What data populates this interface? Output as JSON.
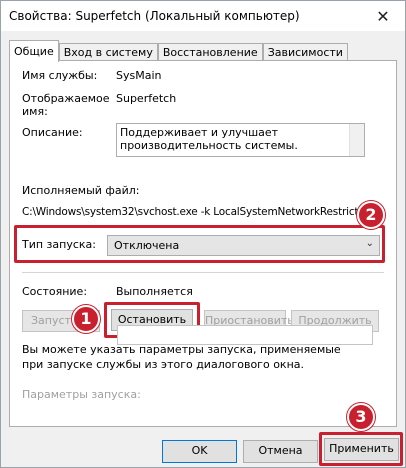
{
  "window": {
    "title": "Свойства: Superfetch (Локальный компьютер)",
    "close_glyph": "✕"
  },
  "tabs": [
    {
      "label": "Общие",
      "active": true
    },
    {
      "label": "Вход в систему",
      "active": false
    },
    {
      "label": "Восстановление",
      "active": false
    },
    {
      "label": "Зависимости",
      "active": false
    }
  ],
  "general": {
    "service_name_label": "Имя службы:",
    "service_name_value": "SysMain",
    "display_name_label_1": "Отображаемое",
    "display_name_label_2": "имя:",
    "display_name_value": "Superfetch",
    "description_label": "Описание:",
    "description_value": "Поддерживает и улучшает производительность системы.",
    "exe_label": "Исполняемый файл:",
    "exe_path": "C:\\Windows\\system32\\svchost.exe -k LocalSystemNetworkRestricted",
    "startup_type_label": "Тип запуска:",
    "startup_type_value": "Отключена",
    "status_label": "Состояние:",
    "status_value": "Выполняется",
    "buttons": {
      "start": "Запустить",
      "stop": "Остановить",
      "pause": "Приостановить",
      "resume": "Продолжить"
    },
    "hint": "Вы можете указать параметры запуска, применяемые при запуске службы из этого диалогового окна.",
    "params_label": "Параметры запуска:",
    "params_value": ""
  },
  "footer": {
    "ok": "OK",
    "cancel": "Отмена",
    "apply": "Применить"
  },
  "annotations": {
    "badge_1": "1",
    "badge_2": "2",
    "badge_3": "3",
    "highlight_color": "#c8202e"
  }
}
